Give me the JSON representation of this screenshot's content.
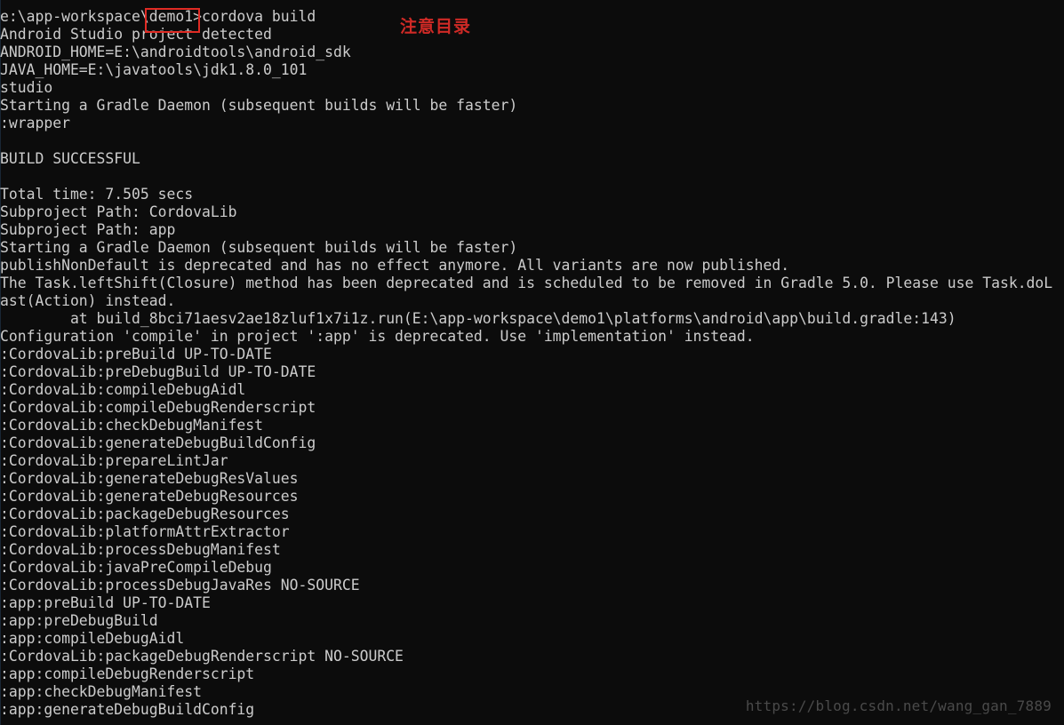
{
  "terminal": {
    "background_color": "#0c0c0c",
    "text_color": "#cccccc",
    "prompt": "e:\\app-workspace\\demo1>",
    "command": "cordova build",
    "lines": [
      "e:\\app-workspace\\demo1>cordova build",
      "Android Studio project detected",
      "ANDROID_HOME=E:\\androidtools\\android_sdk",
      "JAVA_HOME=E:\\javatools\\jdk1.8.0_101",
      "studio",
      "Starting a Gradle Daemon (subsequent builds will be faster)",
      ":wrapper",
      "",
      "BUILD SUCCESSFUL",
      "",
      "Total time: 7.505 secs",
      "Subproject Path: CordovaLib",
      "Subproject Path: app",
      "Starting a Gradle Daemon (subsequent builds will be faster)",
      "publishNonDefault is deprecated and has no effect anymore. All variants are now published.",
      "The Task.leftShift(Closure) method has been deprecated and is scheduled to be removed in Gradle 5.0. Please use Task.doL",
      "ast(Action) instead.",
      "        at build_8bci71aesv2ae18zluf1x7i1z.run(E:\\app-workspace\\demo1\\platforms\\android\\app\\build.gradle:143)",
      "Configuration 'compile' in project ':app' is deprecated. Use 'implementation' instead.",
      ":CordovaLib:preBuild UP-TO-DATE",
      ":CordovaLib:preDebugBuild UP-TO-DATE",
      ":CordovaLib:compileDebugAidl",
      ":CordovaLib:compileDebugRenderscript",
      ":CordovaLib:checkDebugManifest",
      ":CordovaLib:generateDebugBuildConfig",
      ":CordovaLib:prepareLintJar",
      ":CordovaLib:generateDebugResValues",
      ":CordovaLib:generateDebugResources",
      ":CordovaLib:packageDebugResources",
      ":CordovaLib:platformAttrExtractor",
      ":CordovaLib:processDebugManifest",
      ":CordovaLib:javaPreCompileDebug",
      ":CordovaLib:processDebugJavaRes NO-SOURCE",
      ":app:preBuild UP-TO-DATE",
      ":app:preDebugBuild",
      ":app:compileDebugAidl",
      ":CordovaLib:packageDebugRenderscript NO-SOURCE",
      ":app:compileDebugRenderscript",
      ":app:checkDebugManifest",
      ":app:generateDebugBuildConfig"
    ]
  },
  "annotations": {
    "note_text": "注意目录",
    "note_color": "#cf2a26",
    "highlight_box_color": "#e02b24",
    "highlight_target": "\\demo1>"
  },
  "watermark": {
    "text": "https://blog.csdn.net/wang_gan_7889",
    "color": "#4a4a4a"
  }
}
